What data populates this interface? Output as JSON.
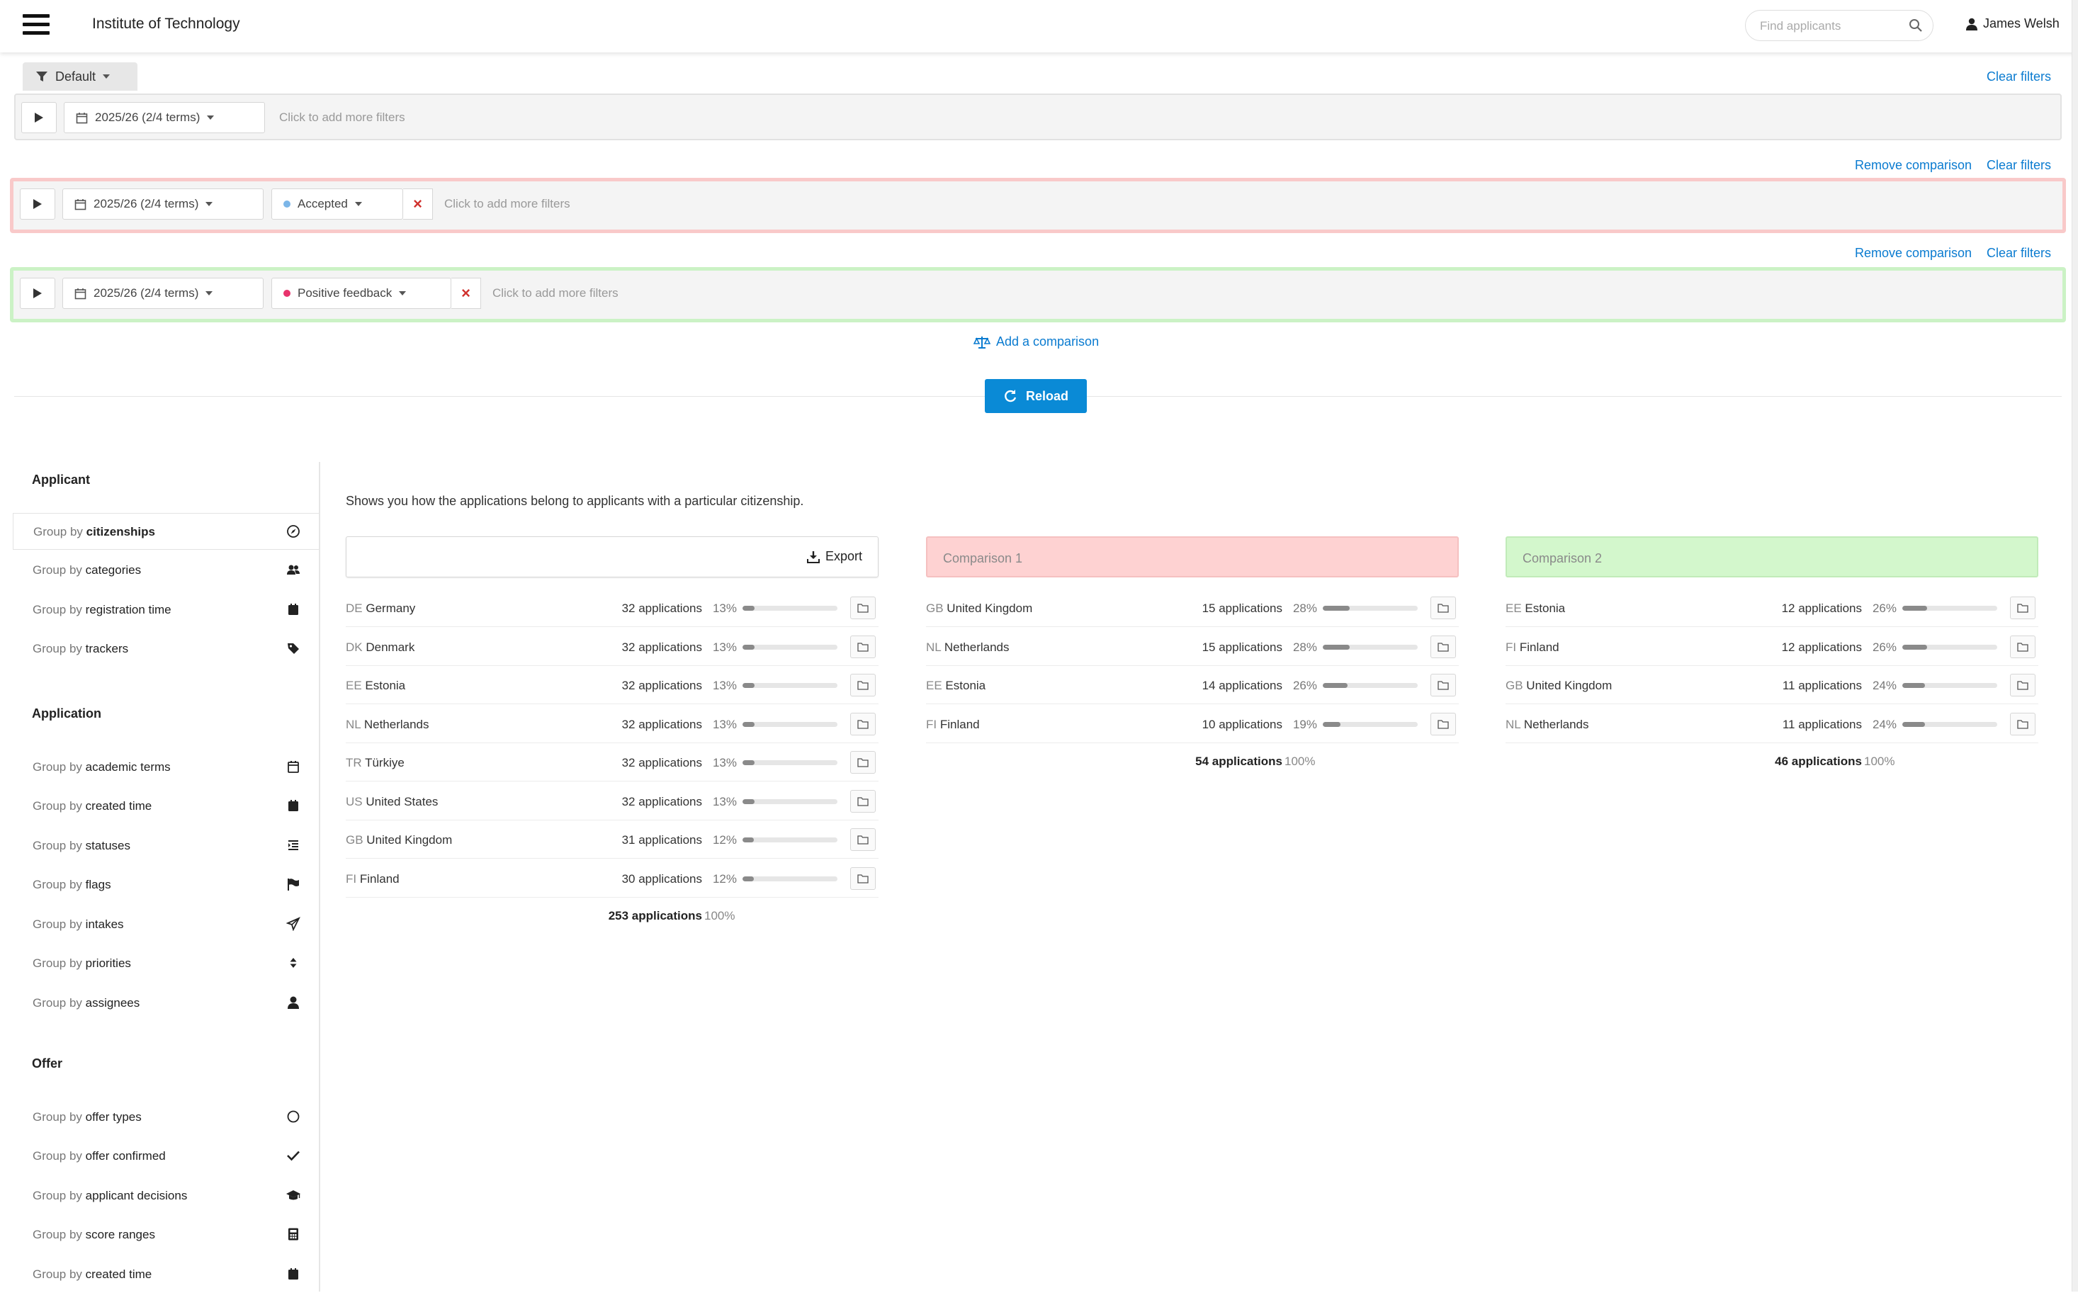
{
  "header": {
    "org_title": "Institute of Technology",
    "search_placeholder": "Find applicants",
    "user_name": "James Welsh"
  },
  "filters": {
    "preset_label": "Default",
    "clear_filters": "Clear filters",
    "remove_comparison": "Remove comparison",
    "add_more_placeholder": "Click to add more filters",
    "add_comparison": "Add a comparison",
    "reload": "Reload",
    "base": {
      "term": "2025/26 (2/4 terms)"
    },
    "comparison_1": {
      "term": "2025/26 (2/4 terms)",
      "status": "Accepted",
      "status_dot_color": "#7cb6e8"
    },
    "comparison_2": {
      "term": "2025/26 (2/4 terms)",
      "status": "Positive feedback",
      "status_dot_color": "#e8336c"
    }
  },
  "sidebar": {
    "prefix": "Group by",
    "sections": [
      {
        "title": "Applicant",
        "items": [
          {
            "label": "citizenships",
            "icon": "compass-icon",
            "active": true
          },
          {
            "label": "categories",
            "icon": "users-icon"
          },
          {
            "label": "registration time",
            "icon": "calendar-icon"
          },
          {
            "label": "trackers",
            "icon": "tag-icon"
          }
        ]
      },
      {
        "title": "Application",
        "items": [
          {
            "label": "academic terms",
            "icon": "calendar-outline-icon"
          },
          {
            "label": "created time",
            "icon": "calendar-icon"
          },
          {
            "label": "statuses",
            "icon": "list-icon"
          },
          {
            "label": "flags",
            "icon": "flag-icon"
          },
          {
            "label": "intakes",
            "icon": "paper-plane-icon"
          },
          {
            "label": "priorities",
            "icon": "sort-icon"
          },
          {
            "label": "assignees",
            "icon": "user-icon"
          }
        ]
      },
      {
        "title": "Offer",
        "items": [
          {
            "label": "offer types",
            "icon": "circle-icon"
          },
          {
            "label": "offer confirmed",
            "icon": "check-icon"
          },
          {
            "label": "applicant decisions",
            "icon": "graduation-cap-icon"
          },
          {
            "label": "score ranges",
            "icon": "calculator-icon"
          },
          {
            "label": "created time",
            "icon": "calendar-icon"
          }
        ]
      }
    ]
  },
  "main": {
    "description": "Shows you how the applications belong to applicants with a particular citizenship.",
    "export_label": "Export",
    "panels": [
      {
        "title": "",
        "rows": [
          {
            "code": "DE",
            "country": "Germany",
            "apps": "32 applications",
            "pct": "13%",
            "value": 0.13
          },
          {
            "code": "DK",
            "country": "Denmark",
            "apps": "32 applications",
            "pct": "13%",
            "value": 0.13
          },
          {
            "code": "EE",
            "country": "Estonia",
            "apps": "32 applications",
            "pct": "13%",
            "value": 0.13
          },
          {
            "code": "NL",
            "country": "Netherlands",
            "apps": "32 applications",
            "pct": "13%",
            "value": 0.13
          },
          {
            "code": "TR",
            "country": "Türkiye",
            "apps": "32 applications",
            "pct": "13%",
            "value": 0.13
          },
          {
            "code": "US",
            "country": "United States",
            "apps": "32 applications",
            "pct": "13%",
            "value": 0.13
          },
          {
            "code": "GB",
            "country": "United Kingdom",
            "apps": "31 applications",
            "pct": "12%",
            "value": 0.12
          },
          {
            "code": "FI",
            "country": "Finland",
            "apps": "30 applications",
            "pct": "12%",
            "value": 0.12
          }
        ],
        "total_apps": "253 applications",
        "total_pct": "100%"
      },
      {
        "title": "Comparison 1",
        "rows": [
          {
            "code": "GB",
            "country": "United Kingdom",
            "apps": "15 applications",
            "pct": "28%",
            "value": 0.28
          },
          {
            "code": "NL",
            "country": "Netherlands",
            "apps": "15 applications",
            "pct": "28%",
            "value": 0.28
          },
          {
            "code": "EE",
            "country": "Estonia",
            "apps": "14 applications",
            "pct": "26%",
            "value": 0.26
          },
          {
            "code": "FI",
            "country": "Finland",
            "apps": "10 applications",
            "pct": "19%",
            "value": 0.19
          }
        ],
        "total_apps": "54 applications",
        "total_pct": "100%"
      },
      {
        "title": "Comparison 2",
        "rows": [
          {
            "code": "EE",
            "country": "Estonia",
            "apps": "12 applications",
            "pct": "26%",
            "value": 0.26
          },
          {
            "code": "FI",
            "country": "Finland",
            "apps": "12 applications",
            "pct": "26%",
            "value": 0.26
          },
          {
            "code": "GB",
            "country": "United Kingdom",
            "apps": "11 applications",
            "pct": "24%",
            "value": 0.24
          },
          {
            "code": "NL",
            "country": "Netherlands",
            "apps": "11 applications",
            "pct": "24%",
            "value": 0.24
          }
        ],
        "total_apps": "46 applications",
        "total_pct": "100%"
      }
    ]
  }
}
